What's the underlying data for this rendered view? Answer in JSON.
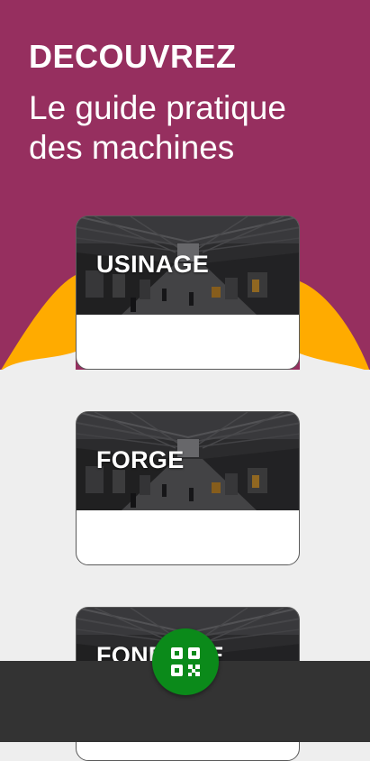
{
  "header": {
    "kicker": "DECOUVREZ",
    "subtitle": "Le guide pratique des machines"
  },
  "cards": [
    {
      "label": "USINAGE"
    },
    {
      "label": "FORGE"
    },
    {
      "label": "FONDERIE"
    }
  ],
  "fab": {
    "icon": "qr-code-icon"
  },
  "colors": {
    "header": "#962f5f",
    "accent": "#ffab00",
    "background": "#eeeeee",
    "bottom_bar": "#333333",
    "fab": "#0b8a1a"
  }
}
